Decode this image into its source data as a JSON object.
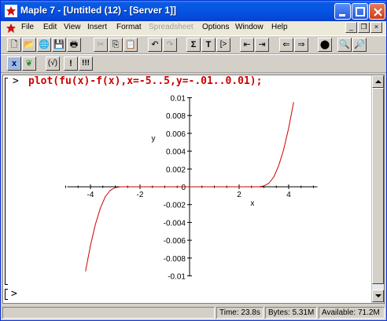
{
  "window": {
    "title": "Maple 7 - [Untitled (12) - [Server 1]]"
  },
  "menu": [
    "File",
    "Edit",
    "View",
    "Insert",
    "Format",
    "Spreadsheet",
    "Options",
    "Window",
    "Help"
  ],
  "menu_disabled": [
    false,
    false,
    false,
    false,
    false,
    true,
    false,
    false,
    false
  ],
  "worksheet": {
    "prompt": ">",
    "input": "plot(fu(x)-f(x),x=-5..5,y=-.01..0.01);",
    "empty_prompt": ">"
  },
  "status": {
    "time": "Time: 23.8s",
    "bytes": "Bytes: 5.31M",
    "available": "Available: 71.2M"
  },
  "chart_data": {
    "type": "line",
    "xlabel": "x",
    "ylabel": "y",
    "xlim": [
      -5,
      5
    ],
    "ylim": [
      -0.01,
      0.01
    ],
    "x_ticks": [
      "-4",
      "-2",
      "0",
      "2",
      "4"
    ],
    "y_ticks": [
      "0.01",
      "0.008",
      "0.006",
      "0.004",
      "0.002",
      "0",
      "-0.002",
      "-0.004",
      "-0.006",
      "-0.008",
      "-0.01"
    ],
    "line_color": "#cc0000",
    "series": [
      {
        "x": [
          -4.2,
          -4.0,
          -3.8,
          -3.6,
          -3.4,
          -3.2,
          -3.0,
          -2.8,
          -2.6,
          -2.4,
          -2.2,
          -2.0,
          0,
          2.0,
          2.2,
          2.4,
          2.6,
          2.8,
          3.0,
          3.2,
          3.4,
          3.6,
          3.8,
          4.0,
          4.2
        ],
        "y": [
          -0.0095,
          -0.0066,
          -0.0042,
          -0.0024,
          -0.0011,
          -0.0004,
          -0.0001,
          0,
          0,
          0,
          0,
          0,
          0,
          0,
          0,
          0,
          0,
          0,
          0.0001,
          0.0004,
          0.0011,
          0.0024,
          0.0042,
          0.0066,
          0.0095
        ]
      }
    ]
  }
}
